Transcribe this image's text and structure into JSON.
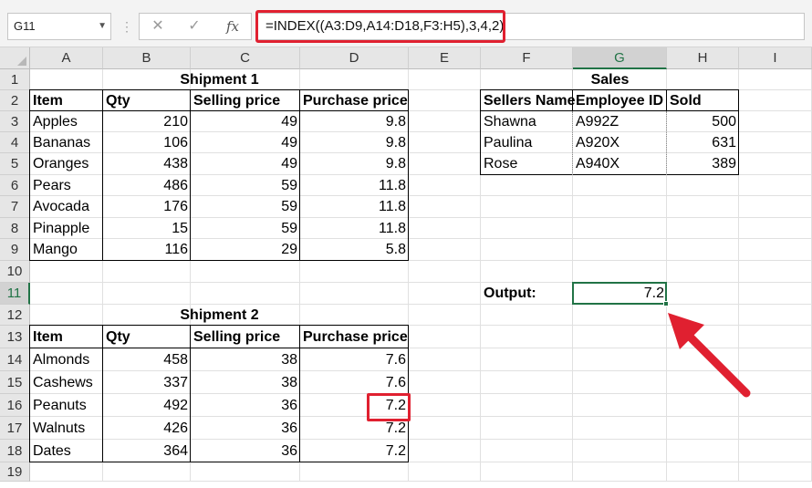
{
  "name_box": {
    "value": "G11"
  },
  "formula_bar": {
    "cancel_glyph": "✕",
    "enter_glyph": "✓",
    "fx_label": "fx",
    "formula": "=INDEX((A3:D9,A14:D18,F3:H5),3,4,2)"
  },
  "columns": [
    "A",
    "B",
    "C",
    "D",
    "E",
    "F",
    "G",
    "H",
    "I"
  ],
  "rows": [
    "1",
    "2",
    "3",
    "4",
    "5",
    "6",
    "7",
    "8",
    "9",
    "10",
    "11",
    "12",
    "13",
    "14",
    "15",
    "16",
    "17",
    "18",
    "19"
  ],
  "selected": {
    "column": "G",
    "row": "11"
  },
  "shipment1": {
    "title": "Shipment 1",
    "headers": [
      "Item",
      "Qty",
      "Selling price",
      "Purchase price"
    ],
    "rows": [
      [
        "Apples",
        "210",
        "49",
        "9.8"
      ],
      [
        "Bananas",
        "106",
        "49",
        "9.8"
      ],
      [
        "Oranges",
        "438",
        "49",
        "9.8"
      ],
      [
        "Pears",
        "486",
        "59",
        "11.8"
      ],
      [
        "Avocada",
        "176",
        "59",
        "11.8"
      ],
      [
        "Pinapple",
        "15",
        "59",
        "11.8"
      ],
      [
        "Mango",
        "116",
        "29",
        "5.8"
      ]
    ]
  },
  "shipment2": {
    "title": "Shipment 2",
    "headers": [
      "Item",
      "Qty",
      "Selling price",
      "Purchase price"
    ],
    "rows": [
      [
        "Almonds",
        "458",
        "38",
        "7.6"
      ],
      [
        "Cashews",
        "337",
        "38",
        "7.6"
      ],
      [
        "Peanuts",
        "492",
        "36",
        "7.2"
      ],
      [
        "Walnuts",
        "426",
        "36",
        "7.2"
      ],
      [
        "Dates",
        "364",
        "36",
        "7.2"
      ]
    ]
  },
  "sales": {
    "title": "Sales",
    "headers": [
      "Sellers Name",
      "Employee ID",
      "Sold"
    ],
    "rows": [
      [
        "Shawna",
        "A992Z",
        "500"
      ],
      [
        "Paulina",
        "A920X",
        "631"
      ],
      [
        "Rose",
        "A940X",
        "389"
      ]
    ]
  },
  "output": {
    "label": "Output:",
    "value": "7.2"
  },
  "colors": {
    "highlight": "#e02030",
    "selection": "#217346"
  }
}
